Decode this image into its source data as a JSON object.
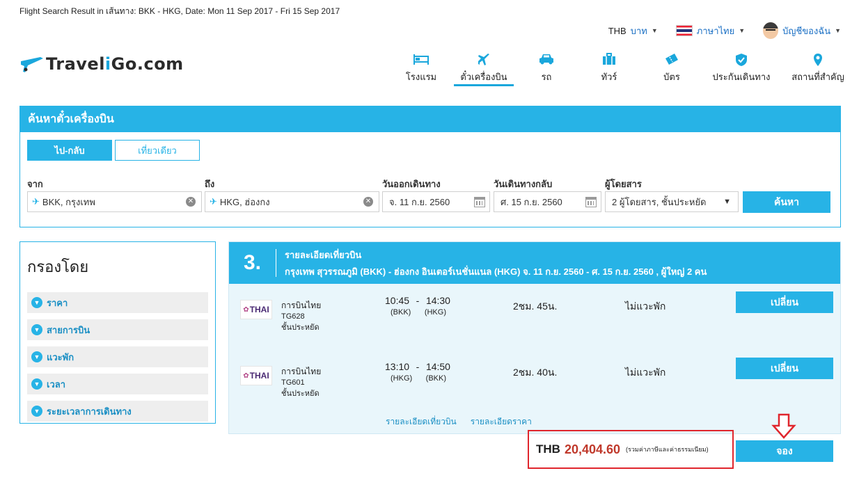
{
  "page": {
    "breadcrumb": "Flight Search Result in เส้นทาง: BKK - HKG, Date: Mon 11 Sep 2017 - Fri 15 Sep 2017"
  },
  "util": {
    "currency_code": "THB",
    "currency_name": "บาท",
    "language": "ภาษาไทย",
    "account": "บัญชีของฉัน"
  },
  "logo": {
    "text_a": "Travel",
    "text_b": "i",
    "text_c": "Go.com"
  },
  "nav": {
    "items": [
      {
        "label": "โรงแรม",
        "icon": "bed-icon"
      },
      {
        "label": "ตั๋วเครื่องบิน",
        "icon": "plane-icon"
      },
      {
        "label": "รถ",
        "icon": "car-icon"
      },
      {
        "label": "ทัวร์",
        "icon": "suitcase-icon"
      },
      {
        "label": "บัตร",
        "icon": "ticket-icon"
      },
      {
        "label": "ประกันเดินทาง",
        "icon": "shield-icon"
      },
      {
        "label": "สถานที่สำคัญ",
        "icon": "location-pin-icon"
      }
    ],
    "active_index": 1
  },
  "search": {
    "title": "ค้นหาตั๋วเครื่องบิน",
    "tab_roundtrip": "ไป-กลับ",
    "tab_oneway": "เที่ยวเดียว",
    "from_label": "จาก",
    "from_value": "BKK, กรุงเทพ",
    "to_label": "ถึง",
    "to_value": "HKG, ฮ่องกง",
    "depart_label": "วันออกเดินทาง",
    "depart_value": "จ. 11 ก.ย. 2560",
    "return_label": "วันเดินทางกลับ",
    "return_value": "ศ. 15 ก.ย. 2560",
    "pax_label": "ผู้โดยสาร",
    "pax_value": "2 ผู้โดยสาร, ชั้นประหยัด",
    "button": "ค้นหา"
  },
  "filter": {
    "title": "กรองโดย",
    "items": [
      "ราคา",
      "สายการบิน",
      "แวะพัก",
      "เวลา",
      "ระยะเวลาการเดินทาง"
    ]
  },
  "result": {
    "step": "3.",
    "title": "รายละเอียดเที่ยวบิน",
    "route": "กรุงเทพ สุวรรณภูมิ (BKK) - ฮ่องกง อินเตอร์เนชั่นแนล (HKG)   จ. 11 ก.ย. 2560 - ศ. 15 ก.ย. 2560 , ผู้ใหญ่ 2 คน",
    "segments": [
      {
        "logo": "THAI",
        "airline": "การบินไทย",
        "flight": "TG628",
        "cabin": "ชั้นประหยัด",
        "dep_time": "10:45",
        "arr_time": "14:30",
        "dep_code": "(BKK)",
        "arr_code": "(HKG)",
        "duration": "2ชม. 45น.",
        "stops": "ไม่แวะพัก",
        "button": "เปลี่ยน"
      },
      {
        "logo": "THAI",
        "airline": "การบินไทย",
        "flight": "TG601",
        "cabin": "ชั้นประหยัด",
        "dep_time": "13:10",
        "arr_time": "14:50",
        "dep_code": "(HKG)",
        "arr_code": "(BKK)",
        "duration": "2ชม. 40น.",
        "stops": "ไม่แวะพัก",
        "button": "เปลี่ยน"
      }
    ],
    "link_flight": "รายละเอียดเที่ยวบิน",
    "link_price": "รายละเอียดราคา"
  },
  "price": {
    "currency": "THB",
    "amount": "20,404.60",
    "note": "(รวมค่าภาษีและค่าธรรมเนียม)",
    "book_button": "จอง"
  },
  "colors": {
    "accent": "#27b3e6",
    "price": "#c0392b",
    "highlight_box": "#e0262d"
  }
}
